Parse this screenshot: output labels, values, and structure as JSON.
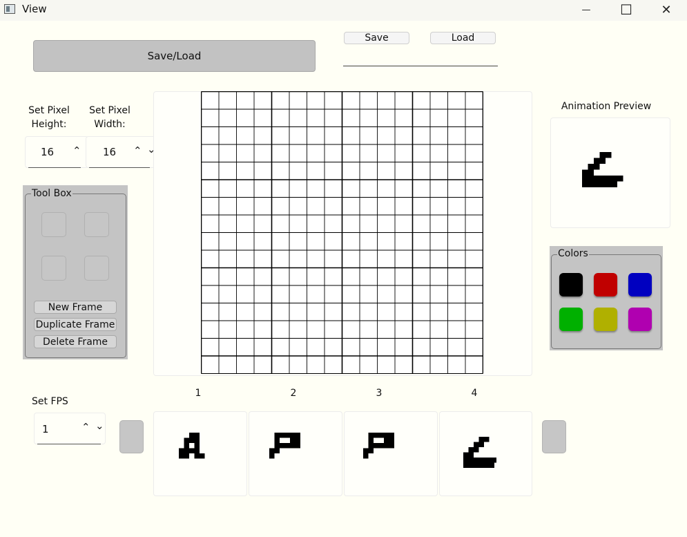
{
  "window": {
    "title": "View",
    "minimize_glyph": "—",
    "maximize_glyph": "☐",
    "close_glyph": "✕"
  },
  "file": {
    "save_load_label": "Save/Load",
    "save_label": "Save",
    "load_label": "Load",
    "filename_value": ""
  },
  "pixel_size": {
    "height_label": "Set Pixel Height:",
    "width_label": "Set Pixel Width:",
    "height_value": "16",
    "width_value": "16"
  },
  "toolbox": {
    "title": "Tool Box",
    "new_frame": "New Frame",
    "duplicate_frame": "Duplicate Frame",
    "delete_frame": "Delete Frame"
  },
  "canvas": {
    "rows": 16,
    "cols": 16
  },
  "preview": {
    "title": "Animation Preview",
    "pixels": [
      [
        3,
        0
      ],
      [
        4,
        0
      ],
      [
        2,
        1
      ],
      [
        3,
        1
      ],
      [
        1,
        2
      ],
      [
        2,
        2
      ],
      [
        0,
        3
      ],
      [
        1,
        3
      ],
      [
        0,
        4
      ],
      [
        1,
        4
      ],
      [
        2,
        4
      ],
      [
        3,
        4
      ],
      [
        4,
        4
      ],
      [
        5,
        4
      ],
      [
        6,
        4
      ],
      [
        0,
        5
      ],
      [
        1,
        5
      ],
      [
        2,
        5
      ],
      [
        3,
        5
      ],
      [
        4,
        5
      ],
      [
        5,
        5
      ]
    ]
  },
  "colors": {
    "title": "Colors",
    "swatches": [
      "#000000",
      "#c00000",
      "#0000c0",
      "#00b000",
      "#b0b000",
      "#b000b0"
    ]
  },
  "fps": {
    "label": "Set FPS",
    "value": "1"
  },
  "frames": [
    {
      "number": "1",
      "pixels": [
        [
          2,
          0
        ],
        [
          3,
          0
        ],
        [
          1,
          1
        ],
        [
          2,
          1
        ],
        [
          3,
          1
        ],
        [
          1,
          2
        ],
        [
          3,
          2
        ],
        [
          0,
          3
        ],
        [
          1,
          3
        ],
        [
          2,
          3
        ],
        [
          3,
          3
        ],
        [
          0,
          4
        ],
        [
          1,
          4
        ],
        [
          3,
          4
        ],
        [
          4,
          4
        ]
      ]
    },
    {
      "number": "2",
      "pixels": [
        [
          1,
          0
        ],
        [
          2,
          0
        ],
        [
          3,
          0
        ],
        [
          4,
          0
        ],
        [
          5,
          0
        ],
        [
          1,
          1
        ],
        [
          4,
          1
        ],
        [
          5,
          1
        ],
        [
          1,
          2
        ],
        [
          2,
          2
        ],
        [
          3,
          2
        ],
        [
          4,
          2
        ],
        [
          5,
          2
        ],
        [
          0,
          3
        ],
        [
          1,
          3
        ],
        [
          0,
          4
        ]
      ]
    },
    {
      "number": "3",
      "pixels": [
        [
          1,
          0
        ],
        [
          2,
          0
        ],
        [
          3,
          0
        ],
        [
          4,
          0
        ],
        [
          5,
          0
        ],
        [
          1,
          1
        ],
        [
          4,
          1
        ],
        [
          5,
          1
        ],
        [
          1,
          2
        ],
        [
          2,
          2
        ],
        [
          3,
          2
        ],
        [
          4,
          2
        ],
        [
          5,
          2
        ],
        [
          0,
          3
        ],
        [
          1,
          3
        ],
        [
          0,
          4
        ]
      ]
    },
    {
      "number": "4",
      "pixels": [
        [
          3,
          0
        ],
        [
          4,
          0
        ],
        [
          2,
          1
        ],
        [
          3,
          1
        ],
        [
          1,
          2
        ],
        [
          2,
          2
        ],
        [
          0,
          3
        ],
        [
          1,
          3
        ],
        [
          0,
          4
        ],
        [
          1,
          4
        ],
        [
          2,
          4
        ],
        [
          3,
          4
        ],
        [
          4,
          4
        ],
        [
          5,
          4
        ],
        [
          6,
          4
        ],
        [
          0,
          5
        ],
        [
          1,
          5
        ],
        [
          2,
          5
        ],
        [
          3,
          5
        ],
        [
          4,
          5
        ],
        [
          5,
          5
        ]
      ]
    }
  ]
}
